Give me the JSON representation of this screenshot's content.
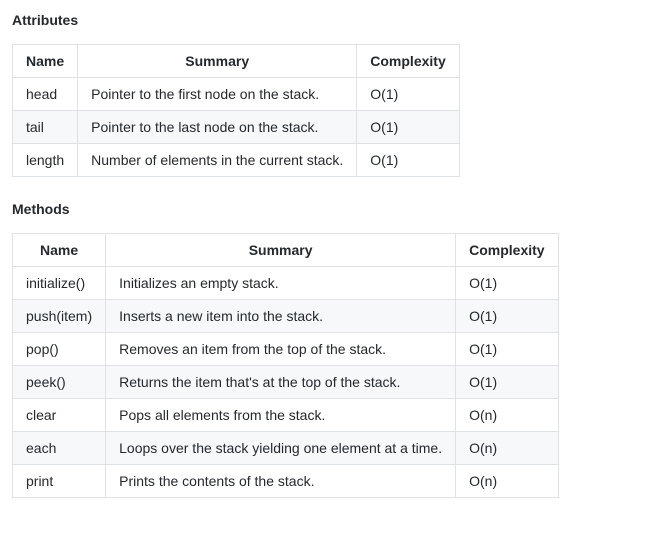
{
  "sections": [
    {
      "title": "Attributes",
      "headers": [
        "Name",
        "Summary",
        "Complexity"
      ],
      "rows": [
        {
          "name": "head",
          "summary": "Pointer to the first node on the stack.",
          "complexity": "O(1)"
        },
        {
          "name": "tail",
          "summary": "Pointer to the last node on the stack.",
          "complexity": "O(1)"
        },
        {
          "name": "length",
          "summary": "Number of elements in the current stack.",
          "complexity": "O(1)"
        }
      ]
    },
    {
      "title": "Methods",
      "headers": [
        "Name",
        "Summary",
        "Complexity"
      ],
      "rows": [
        {
          "name": "initialize()",
          "summary": "Initializes an empty stack.",
          "complexity": "O(1)"
        },
        {
          "name": "push(item)",
          "summary": "Inserts a new item into the stack.",
          "complexity": "O(1)"
        },
        {
          "name": "pop()",
          "summary": "Removes an item from the top of the stack.",
          "complexity": "O(1)"
        },
        {
          "name": "peek()",
          "summary": "Returns the item that's at the top of the stack.",
          "complexity": "O(1)"
        },
        {
          "name": "clear",
          "summary": "Pops all elements from the stack.",
          "complexity": "O(n)"
        },
        {
          "name": "each",
          "summary": "Loops over the stack yielding one element at a time.",
          "complexity": "O(n)"
        },
        {
          "name": "print",
          "summary": "Prints the contents of the stack.",
          "complexity": "O(n)"
        }
      ]
    }
  ]
}
